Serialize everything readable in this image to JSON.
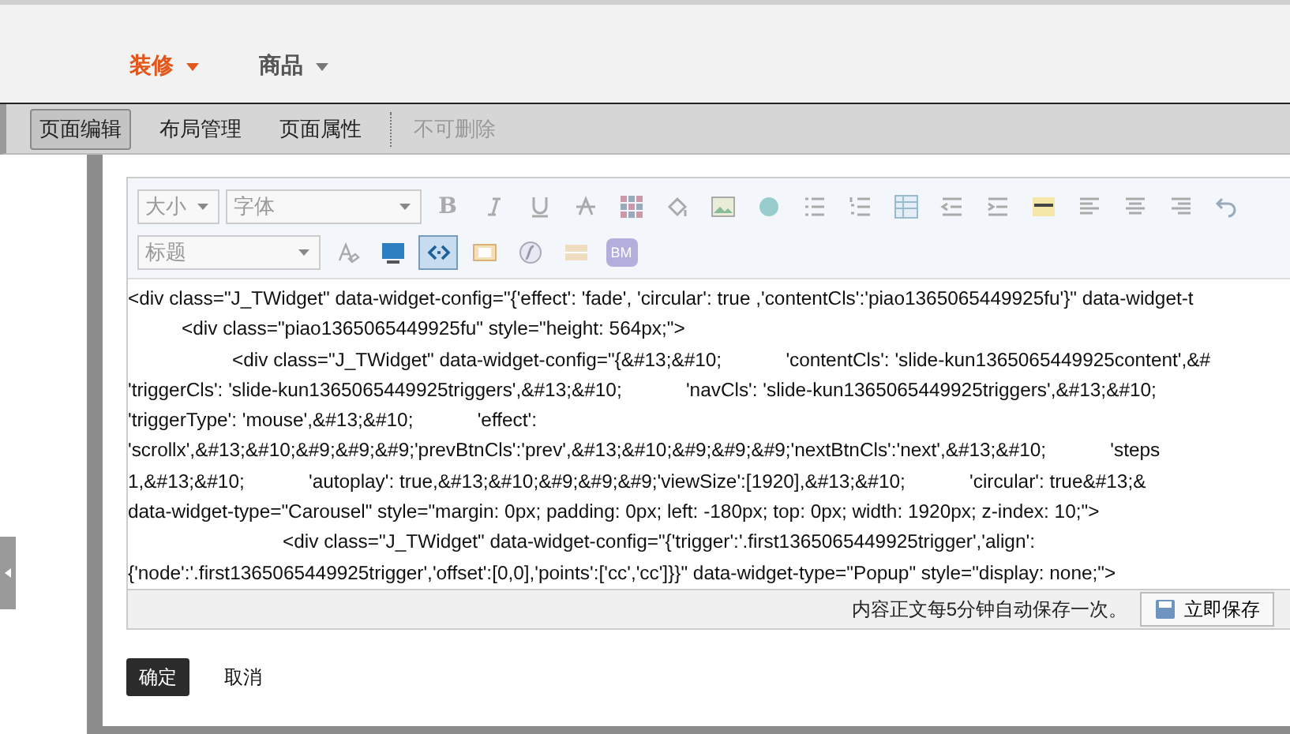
{
  "nav": [
    {
      "label": "装修",
      "selected": true
    },
    {
      "label": "商品",
      "selected": false
    }
  ],
  "page_tabs": [
    {
      "label": "页面编辑",
      "selected": true,
      "disabled": false
    },
    {
      "label": "布局管理",
      "selected": false,
      "disabled": false
    },
    {
      "label": "页面属性",
      "selected": false,
      "disabled": false
    },
    {
      "label": "不可删除",
      "selected": false,
      "disabled": true
    }
  ],
  "editor_toolbar": {
    "bold_label": "B",
    "size_select": "大小",
    "font_select": "字体",
    "heading_select": "标题",
    "source_button": {
      "selected": true
    },
    "bookmark_label": "BM"
  },
  "code_lines": [
    {
      "kind": "flush",
      "text": "<div class=\"J_TWidget\" data-widget-config=\"{'effect': 'fade', 'circular': true ,'contentCls':'piao1365065449925fu'}\" data-widget-t"
    },
    {
      "kind": "tab",
      "text": "<div class=\"piao1365065449925fu\" style=\"height: 564px;\">"
    },
    {
      "kind": "double",
      "text": "<div class=\"J_TWidget\" data-widget-config=\"{&#13;&#10;            'contentCls': 'slide-kun1365065449925content',&#"
    },
    {
      "kind": "flush",
      "text": "'triggerCls': 'slide-kun1365065449925triggers',&#13;&#10;            'navCls': 'slide-kun1365065449925triggers',&#13;&#10;"
    },
    {
      "kind": "flush",
      "text": "'triggerType': 'mouse',&#13;&#10;            'effect':"
    },
    {
      "kind": "flush",
      "text": "'scrollx',&#13;&#10;&#9;&#9;&#9;'prevBtnCls':'prev',&#13;&#10;&#9;&#9;&#9;'nextBtnCls':'next',&#13;&#10;            'steps"
    },
    {
      "kind": "flush",
      "text": "1,&#13;&#10;            'autoplay': true,&#13;&#10;&#9;&#9;&#9;'viewSize':[1920],&#13;&#10;            'circular': true&#13;&"
    },
    {
      "kind": "flush",
      "text": "data-widget-type=\"Carousel\" style=\"margin: 0px; padding: 0px; left: -180px; top: 0px; width: 1920px; z-index: 10;\">"
    },
    {
      "kind": "triple",
      "text": "<div class=\"J_TWidget\" data-widget-config=\"{'trigger':'.first1365065449925trigger','align':"
    },
    {
      "kind": "flush",
      "text": "{'node':'.first1365065449925trigger','offset':[0,0],'points':['cc','cc']}}\" data-widget-type=\"Popup\" style=\"display: none;\">"
    }
  ],
  "autosave_note": "内容正文每5分钟自动保存一次。",
  "save_now_button": "立即保存",
  "buttons": [
    {
      "kind": "primary",
      "label": "确定"
    },
    {
      "kind": "plain",
      "label": "取消"
    }
  ]
}
